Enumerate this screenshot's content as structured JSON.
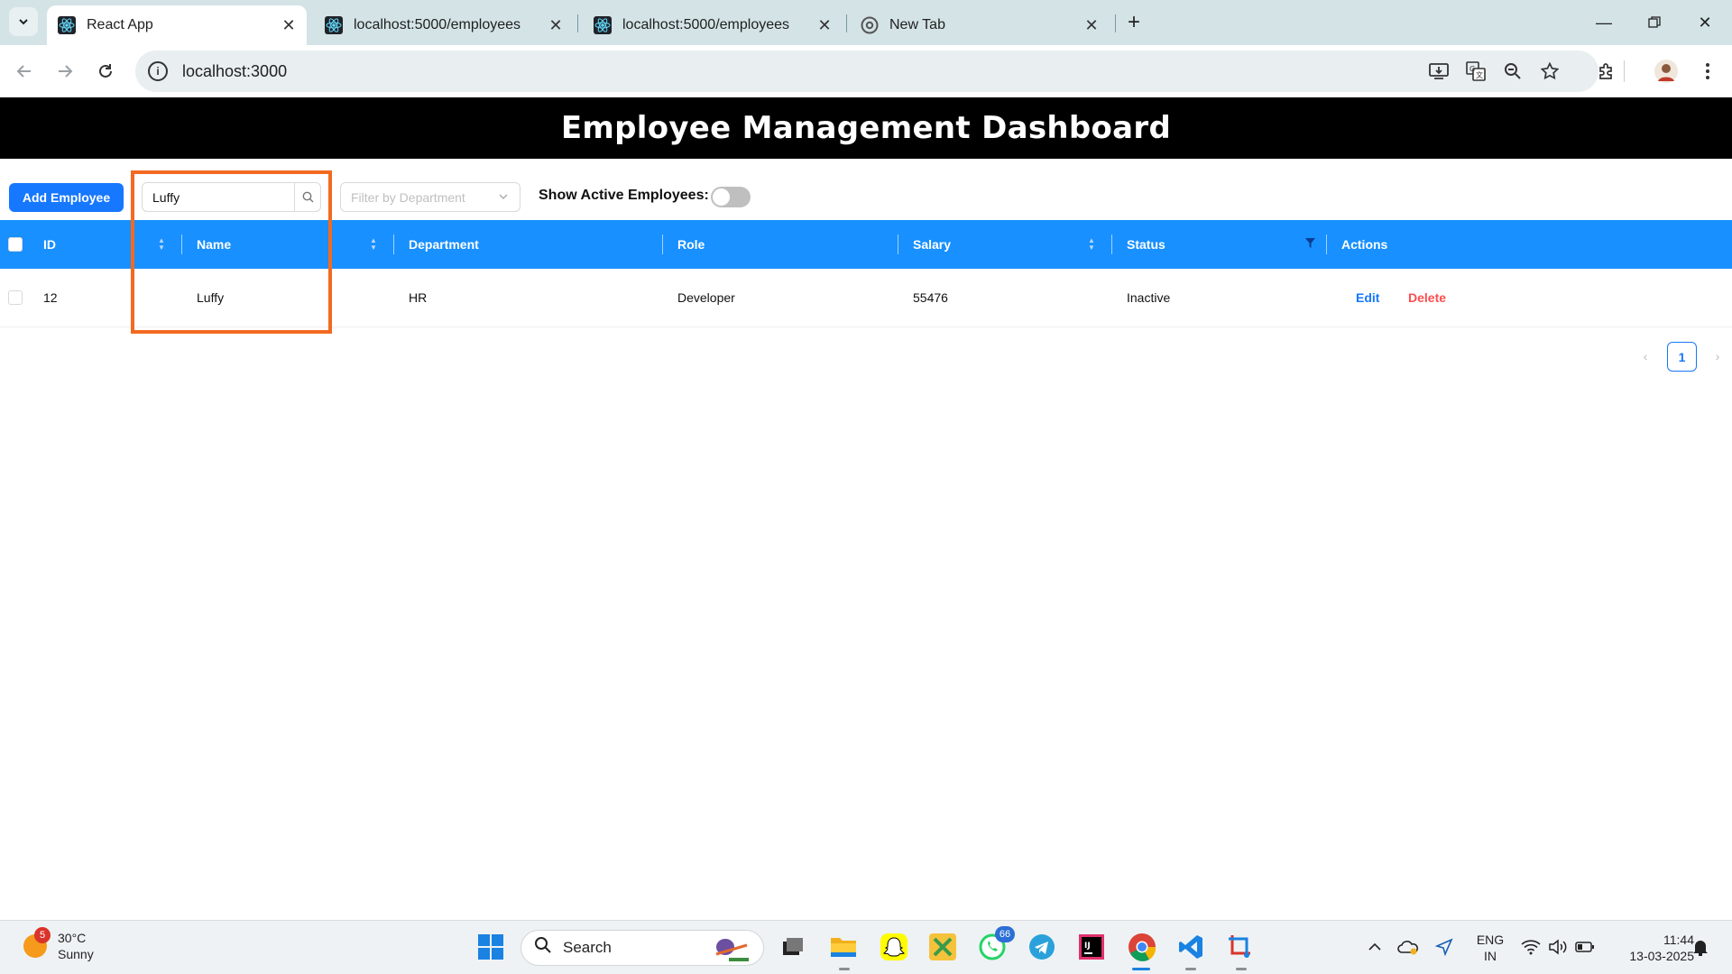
{
  "browser": {
    "tabs": [
      {
        "title": "React App",
        "active": true
      },
      {
        "title": "localhost:5000/employees",
        "active": false
      },
      {
        "title": "localhost:5000/employees",
        "active": false
      },
      {
        "title": "New Tab",
        "active": false
      }
    ],
    "url": "localhost:3000"
  },
  "app": {
    "title": "Employee Management Dashboard",
    "add_button": "Add Employee",
    "search": {
      "value": "Luffy"
    },
    "department_filter": {
      "placeholder": "Filter by Department"
    },
    "active_label": "Show Active Employees:",
    "active_toggle_on": false,
    "accent_color": "#1890ff",
    "highlight_color": "#f26a21"
  },
  "table": {
    "columns": [
      "ID",
      "Name",
      "Department",
      "Role",
      "Salary",
      "Status",
      "Actions"
    ],
    "rows": [
      {
        "id": "12",
        "name": "Luffy",
        "department": "HR",
        "role": "Developer",
        "salary": "55476",
        "status": "Inactive",
        "edit": "Edit",
        "delete": "Delete"
      }
    ]
  },
  "pagination": {
    "current_page": "1",
    "prev": "‹",
    "next": "›"
  },
  "taskbar": {
    "weather": {
      "temp": "30°C",
      "condition": "Sunny",
      "badge": "5"
    },
    "search_label": "Search",
    "whatsapp_badge": "66",
    "language": {
      "line1": "ENG",
      "line2": "IN"
    },
    "time": "11:44",
    "date": "13-03-2025"
  }
}
